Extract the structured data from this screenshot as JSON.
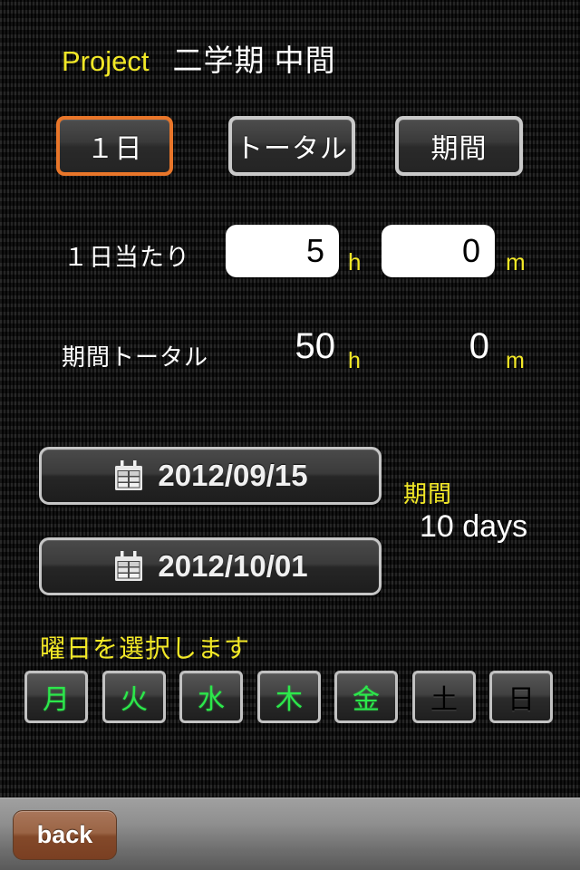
{
  "header": {
    "project_label": "Project",
    "project_title": "二学期 中間"
  },
  "tabs": [
    {
      "label": "１日",
      "name": "tab-per-day",
      "selected": true
    },
    {
      "label": "トータル",
      "name": "tab-total",
      "selected": false
    },
    {
      "label": "期間",
      "name": "tab-period",
      "selected": false
    }
  ],
  "per_day": {
    "label": "１日当たり",
    "hours_value": "5",
    "hours_unit": "h",
    "minutes_value": "0",
    "minutes_unit": "m",
    "hours_placeholder": "0",
    "minutes_placeholder": "0"
  },
  "period_total": {
    "label": "期間トータル",
    "hours_value": "50",
    "hours_unit": "h",
    "minutes_value": "0",
    "minutes_unit": "m"
  },
  "dates": {
    "start": "2012/09/15",
    "end": "2012/10/01",
    "calendar_icon": "calendar-icon"
  },
  "period": {
    "label": "期間",
    "value": "10 days"
  },
  "weekday": {
    "hint": "曜日を選択します",
    "items": [
      {
        "label": "月",
        "name": "weekday-mon",
        "selected": true
      },
      {
        "label": "火",
        "name": "weekday-tue",
        "selected": true
      },
      {
        "label": "水",
        "name": "weekday-wed",
        "selected": true
      },
      {
        "label": "木",
        "name": "weekday-thu",
        "selected": true
      },
      {
        "label": "金",
        "name": "weekday-fri",
        "selected": true
      },
      {
        "label": "土",
        "name": "weekday-sat",
        "selected": false
      },
      {
        "label": "日",
        "name": "weekday-sun",
        "selected": false
      }
    ]
  },
  "toolbar": {
    "back_label": "back"
  },
  "colors": {
    "accent_yellow": "#f2e827",
    "selected_tab_border": "#e9762a",
    "selected_weekday_text": "#2ce84b",
    "background": "#111111",
    "toolbar_top": "#a0a0a0",
    "back_button": "#9a6445"
  }
}
